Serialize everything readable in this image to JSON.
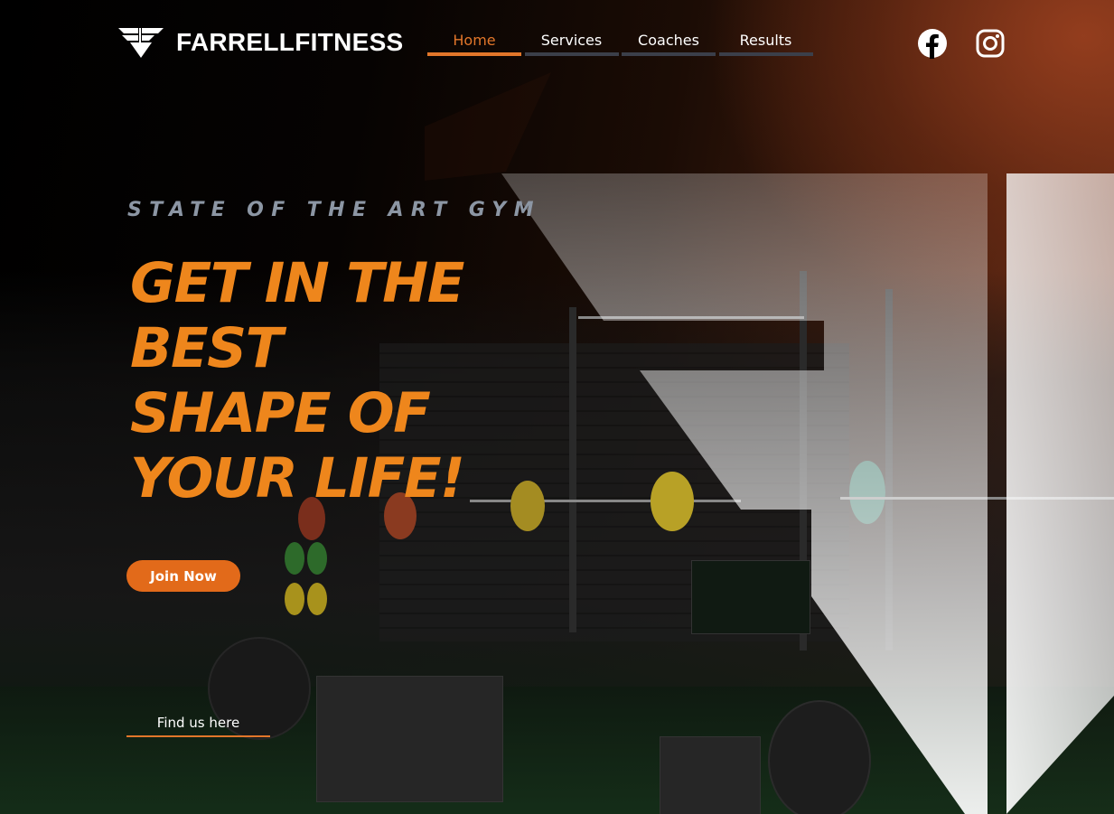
{
  "header": {
    "brand_name": "FARRELLFITNESS",
    "nav": [
      {
        "label": "Home",
        "active": true
      },
      {
        "label": "Services",
        "active": false
      },
      {
        "label": "Coaches",
        "active": false
      },
      {
        "label": "Results",
        "active": false
      }
    ],
    "social": [
      {
        "icon": "facebook-icon"
      },
      {
        "icon": "instagram-icon"
      }
    ]
  },
  "hero": {
    "eyebrow": "STATE OF THE ART GYM",
    "headline_lines": [
      "GET IN THE",
      "BEST",
      "SHAPE OF",
      "YOUR LIFE!"
    ],
    "cta_label": "Join Now",
    "find_label": "Find us here"
  },
  "colors": {
    "accent": "#e2762a",
    "headline": "#ee861c",
    "nav_underline": "#3b3f4a",
    "eyebrow": "#8c96a4"
  }
}
